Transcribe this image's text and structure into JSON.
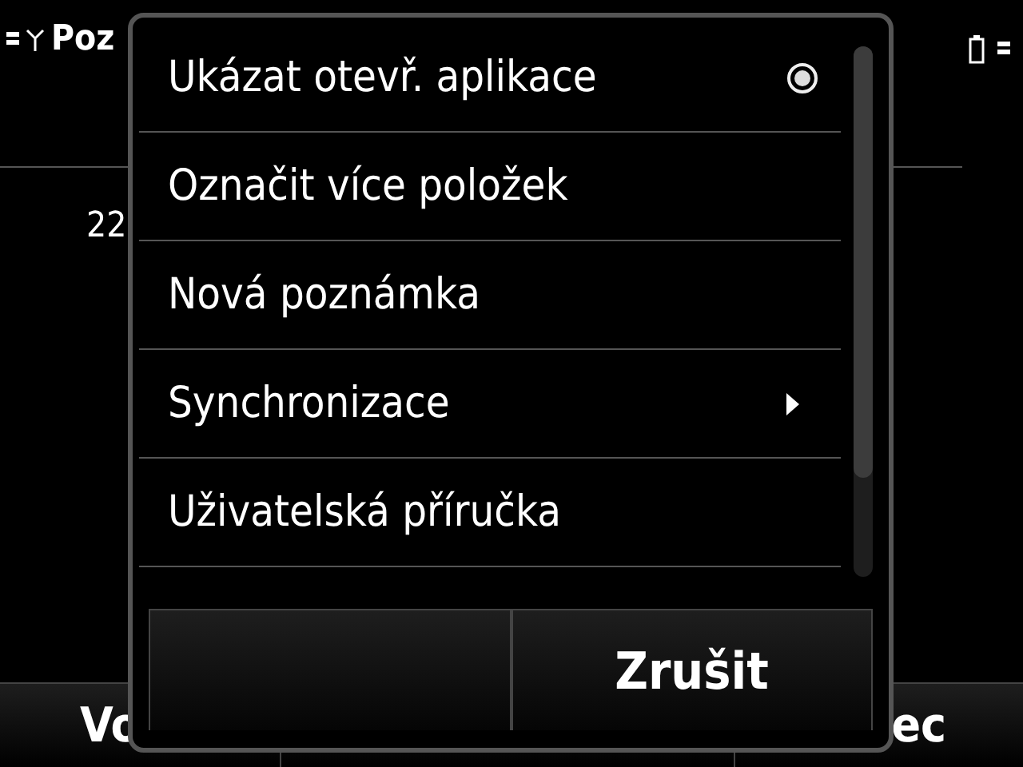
{
  "status_bar": {
    "title": "Poz"
  },
  "background": {
    "value": "22"
  },
  "softkeys": {
    "left": "Vo",
    "right": "ec"
  },
  "menu": {
    "items": [
      {
        "label": "Ukázat otevř. aplikace",
        "kind": "radio",
        "checked": true
      },
      {
        "label": "Označit více položek",
        "kind": "plain"
      },
      {
        "label": "Nová poznámka",
        "kind": "plain"
      },
      {
        "label": "Synchronizace",
        "kind": "submenu"
      },
      {
        "label": "Uživatelská příručka",
        "kind": "plain"
      }
    ]
  },
  "buttons": [
    {
      "kind": "blank"
    },
    {
      "kind": "text",
      "label": "Zrušit"
    }
  ]
}
